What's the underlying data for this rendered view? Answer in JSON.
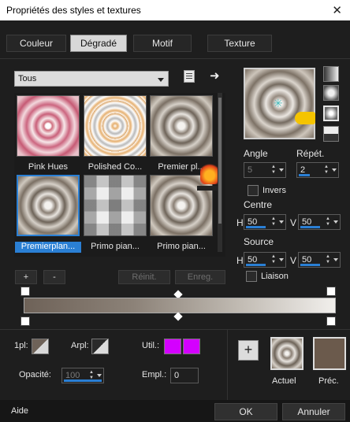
{
  "window": {
    "title": "Propriétés des styles et textures"
  },
  "tabs": [
    {
      "label": "Couleur"
    },
    {
      "label": "Dégradé"
    },
    {
      "label": "Motif"
    },
    {
      "label": "Texture"
    }
  ],
  "library": {
    "category": "Tous",
    "items": [
      {
        "label": "Pink Hues"
      },
      {
        "label": "Polished Co..."
      },
      {
        "label": "Premier pl..."
      },
      {
        "label": "Premierplan..."
      },
      {
        "label": "Primo pian..."
      },
      {
        "label": "Primo pian..."
      }
    ],
    "add_label": "+",
    "remove_label": "-",
    "reset_label": "Réinit.",
    "save_label": "Enreg."
  },
  "params": {
    "angle_label": "Angle",
    "angle_value": "5",
    "repeat_label": "Répét.",
    "repeat_value": "2",
    "invert_label": "Invers",
    "center_label": "Centre",
    "center_h_label": "H",
    "center_h": "50",
    "center_v_label": "V",
    "center_v": "50",
    "source_label": "Source",
    "source_h_label": "H",
    "source_h": "50",
    "source_v_label": "V",
    "source_v": "50",
    "link_label": "Liaison"
  },
  "stops": {
    "first_label": "1pl:",
    "arpl_label": "Arpl:",
    "util_label": "Util.:",
    "opacity_label": "Opacité:",
    "opacity_value": "100",
    "empl_label": "Empl.:",
    "empl_value": "0",
    "util_color": "#d400ff"
  },
  "swatches": {
    "add_label": "+",
    "actual_label": "Actuel",
    "prev_label": "Préc.",
    "prev_color": "#6b5a4c"
  },
  "footer": {
    "help_label": "Aide",
    "ok_label": "OK",
    "cancel_label": "Annuler"
  }
}
